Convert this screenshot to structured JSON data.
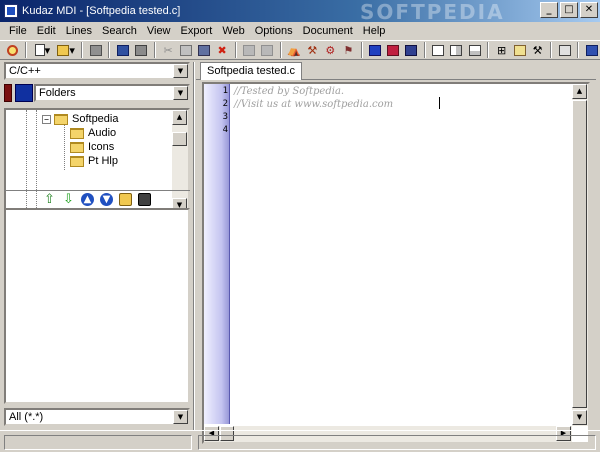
{
  "window": {
    "title": "Kudaz MDI - [Softpedia tested.c]",
    "watermark": "SOFTPEDIA",
    "buttons": [
      "_",
      "□",
      "✕"
    ]
  },
  "menu": [
    "File",
    "Edit",
    "Lines",
    "Search",
    "View",
    "Export",
    "Web",
    "Options",
    "Document",
    "Help"
  ],
  "toolbar": {
    "icons": [
      "find-magnifier-icon",
      "new-document-icon",
      "open-folder-icon",
      "save-icon",
      "cut-icon",
      "copy-icon",
      "paste-icon",
      "delete-icon",
      "find-icon",
      "replace-icon",
      "color-scheme-icon",
      "layout-icon",
      "table-icon",
      "clipboard-icon",
      "print-icon",
      "exit-icon"
    ]
  },
  "left": {
    "language": "C/C++",
    "view_mode": "Folders",
    "tree": {
      "root": "Softpedia",
      "children": [
        "Audio",
        "Icons",
        "Pt Hlp"
      ]
    },
    "filter": "All (*.*)"
  },
  "editor": {
    "tab": "Softpedia tested.c",
    "lines": [
      {
        "n": "1",
        "text": "//Tested by Softpedia."
      },
      {
        "n": "2",
        "text": "//Visit us at www.softpedia.com"
      },
      {
        "n": "3",
        "text": ""
      },
      {
        "n": "4",
        "text": ""
      }
    ]
  },
  "colors": {
    "titlebar": "#0a246a",
    "gutter": "#9898d8",
    "comment": "#a0a0a0"
  }
}
